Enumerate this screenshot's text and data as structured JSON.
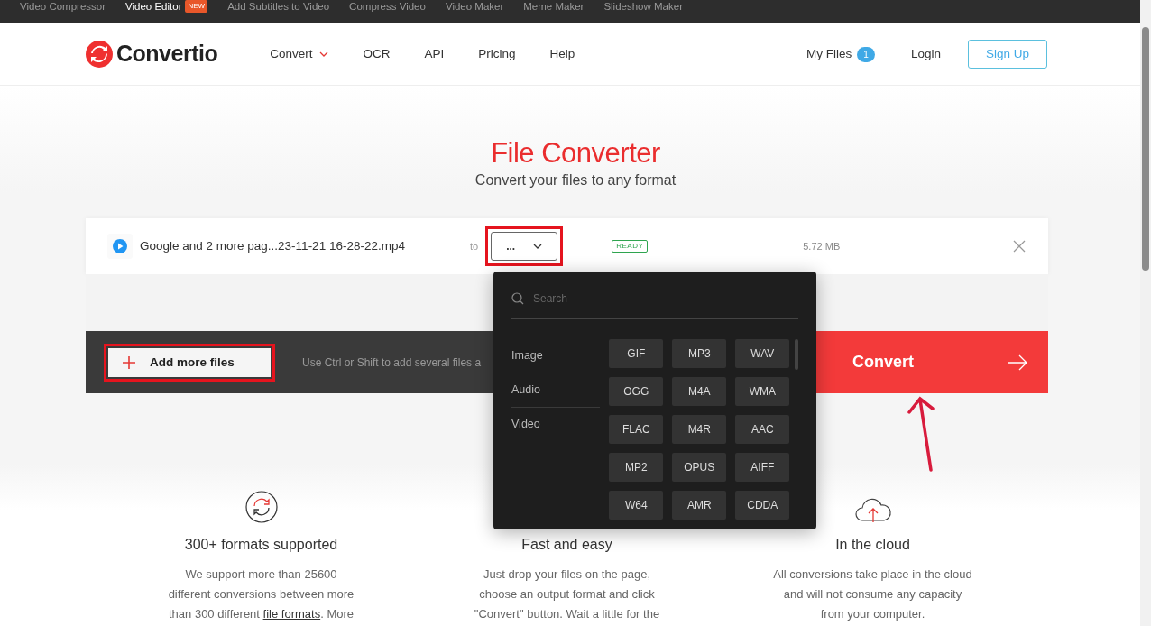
{
  "top_links": [
    {
      "label": "Video Compressor",
      "selected": false
    },
    {
      "label": "Video Editor",
      "selected": true,
      "badge": "NEW"
    },
    {
      "label": "Add Subtitles to Video",
      "selected": false
    },
    {
      "label": "Compress Video",
      "selected": false
    },
    {
      "label": "Video Maker",
      "selected": false
    },
    {
      "label": "Meme Maker",
      "selected": false
    },
    {
      "label": "Slideshow Maker",
      "selected": false
    }
  ],
  "header": {
    "logo": "Convertio",
    "nav": [
      {
        "label": "Convert",
        "dropdown": true
      },
      {
        "label": "OCR",
        "dropdown": false
      },
      {
        "label": "API",
        "dropdown": false
      },
      {
        "label": "Pricing",
        "dropdown": false
      },
      {
        "label": "Help",
        "dropdown": false
      }
    ],
    "my_files": {
      "label": "My Files",
      "count": "1"
    },
    "login": "Login",
    "signup": "Sign Up"
  },
  "hero": {
    "title": "File Converter",
    "subtitle": "Convert your files to any format"
  },
  "file": {
    "name": "Google and 2 more pag...23-11-21 16-28-22.mp4",
    "to": "to",
    "format": "...",
    "status": "READY",
    "size": "5.72 MB"
  },
  "actions": {
    "add": "Add more files",
    "hint": "Use Ctrl or Shift to add several files a",
    "convert": "Convert"
  },
  "format_menu": {
    "placeholder": "Search",
    "categories": [
      "Image",
      "Audio",
      "Video"
    ],
    "formats": [
      "GIF",
      "MP3",
      "WAV",
      "OGG",
      "M4A",
      "WMA",
      "FLAC",
      "M4R",
      "AAC",
      "MP2",
      "OPUS",
      "AIFF",
      "W64",
      "AMR",
      "CDDA"
    ]
  },
  "features": [
    {
      "kind": "formats",
      "title": "300+ formats supported",
      "parts": [
        {
          "text": "We support more than 25600\ndifferent conversions between more\nthan 300 different ",
          "kind": "text"
        },
        {
          "text": "file formats",
          "kind": "link"
        },
        {
          "text": ". More",
          "kind": "text"
        }
      ]
    },
    {
      "kind": "fast",
      "title": "Fast and easy",
      "parts": [
        {
          "text": "Just drop your files on the page,\nchoose an output format and click\n\"Convert\" button. Wait a little for the",
          "kind": "text"
        }
      ]
    },
    {
      "kind": "cloud",
      "title": "In the cloud",
      "parts": [
        {
          "text": "All conversions take place in the cloud\nand will not consume any capacity\nfrom your computer.",
          "kind": "text"
        }
      ]
    }
  ]
}
